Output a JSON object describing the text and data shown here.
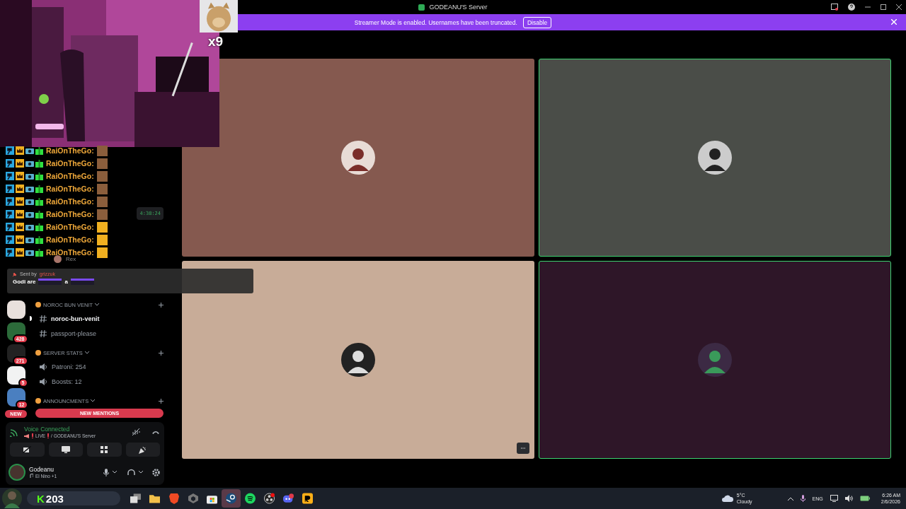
{
  "title_bar": {
    "title": "GODEANU'S Server"
  },
  "banner": {
    "text": "Streamer Mode is enabled. Usernames have been truncated.",
    "button": "Disable"
  },
  "webcam": {
    "multiplier": "x9"
  },
  "chat_overlay": [
    {
      "user": "RaiOnTheGo:",
      "color": "#8b5e3c"
    },
    {
      "user": "RaiOnTheGo:",
      "color": "#8b5e3c"
    },
    {
      "user": "RaiOnTheGo:",
      "color": "#8b5e3c"
    },
    {
      "user": "RaiOnTheGo:",
      "color": "#8b5e3c"
    },
    {
      "user": "RaiOnTheGo:",
      "color": "#8b5e3c"
    },
    {
      "user": "RaiOnTheGo:",
      "color": "#8b5e3c"
    },
    {
      "user": "RaiOnTheGo:",
      "color": "#f0b020"
    },
    {
      "user": "RaiOnTheGo:",
      "color": "#f0b020"
    },
    {
      "user": "RaiOnTheGo:",
      "color": "#f0b020"
    }
  ],
  "pinned_toast": {
    "sent_by": "Sent by",
    "sender": "grizzuk",
    "message": "Godi are",
    "joiner": "a"
  },
  "voice_channel": {
    "timer": "4:38:24",
    "member": "Rex"
  },
  "servers": [
    {
      "color": "#e8e0dc"
    },
    {
      "color": "#2c6b3a",
      "badge": "428"
    },
    {
      "color": "#222222",
      "badge": "271"
    },
    {
      "color": "#f2f2f2",
      "badge": "5"
    },
    {
      "color": "#4a7fc0",
      "badge": "12"
    }
  ],
  "new_pill": "NEW",
  "channels": [
    {
      "kind": "category",
      "name": "NOROC BUN VENIT"
    },
    {
      "kind": "text",
      "name": "noroc-bun-venit",
      "unread": true
    },
    {
      "kind": "text",
      "name": "passport-please",
      "unread": false
    },
    {
      "kind": "category",
      "name": "SERVER STATS"
    },
    {
      "kind": "voice",
      "name": "Patroni: 254"
    },
    {
      "kind": "voice",
      "name": "Boosts: 12"
    },
    {
      "kind": "category",
      "name": "ANNOUNCMENTS"
    }
  ],
  "new_mentions": "NEW MENTIONS",
  "voice_panel": {
    "status": "Voice Connected",
    "live": "LIVE",
    "server": "/ GODEANU'S Server"
  },
  "user_panel": {
    "name": "Godeanu",
    "activity": "El Nino +1"
  },
  "tiles": [
    {
      "color": "#85594f",
      "speaking": false,
      "more": false
    },
    {
      "color": "#4a4d48",
      "speaking": true,
      "more": false
    },
    {
      "color": "#c8ac98",
      "speaking": false,
      "more": true
    },
    {
      "color": "#2e1628",
      "speaking": true,
      "more": false
    }
  ],
  "taskbar": {
    "search_badge": "K",
    "search_count": "203",
    "apps": [
      {
        "kind": "taskview",
        "active": false
      },
      {
        "kind": "folder",
        "active": false
      },
      {
        "kind": "brave",
        "active": false
      },
      {
        "kind": "cube",
        "active": false
      },
      {
        "kind": "store",
        "active": false
      },
      {
        "kind": "steam",
        "active": true
      },
      {
        "kind": "spotify",
        "active": false
      },
      {
        "kind": "obs",
        "active": false
      },
      {
        "kind": "discord",
        "active": false
      },
      {
        "kind": "rockstar",
        "active": false
      }
    ],
    "temperature": "5°C",
    "weather": "Cloudy",
    "language": "ENG",
    "time": "6:26 AM",
    "date": "2/6/2026"
  }
}
